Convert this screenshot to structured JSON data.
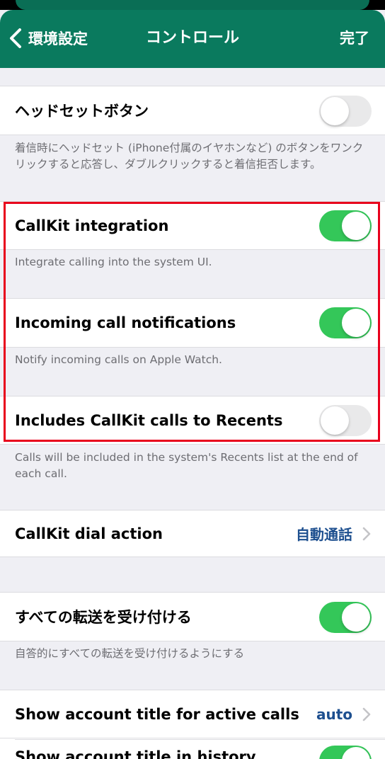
{
  "nav": {
    "back_label": "環境設定",
    "title": "コントロール",
    "done_label": "完了"
  },
  "headset": {
    "label": "ヘッドセットボタン",
    "enabled": false,
    "footer": "着信時にヘッドセット (iPhone付属のイヤホンなど) のボタンをワンクリックすると応答し、ダブルクリックすると着信拒否します。"
  },
  "callkit": {
    "label": "CallKit integration",
    "enabled": true,
    "footer": "Integrate calling into the system UI."
  },
  "incoming": {
    "label": "Incoming call notifications",
    "enabled": true,
    "footer": "Notify incoming calls on Apple Watch."
  },
  "recents": {
    "label": "Includes CallKit calls to Recents",
    "enabled": false,
    "footer": "Calls will be included in the system's Recents list at the end of each call."
  },
  "dial_action": {
    "label": "CallKit dial action",
    "value": "自動通話"
  },
  "accept_transfers": {
    "label": "すべての転送を受け付ける",
    "enabled": true,
    "footer": "自答的にすべての転送を受け付けるようにする"
  },
  "account_title_active": {
    "label": "Show account title for active calls",
    "value": "auto"
  },
  "account_title_history": {
    "label": "Show account title in history",
    "enabled": true
  },
  "colors": {
    "nav": "#0a7a5e",
    "switch_on": "#34c759",
    "value_text": "#1d4f8f",
    "highlight": "#e8001c"
  }
}
